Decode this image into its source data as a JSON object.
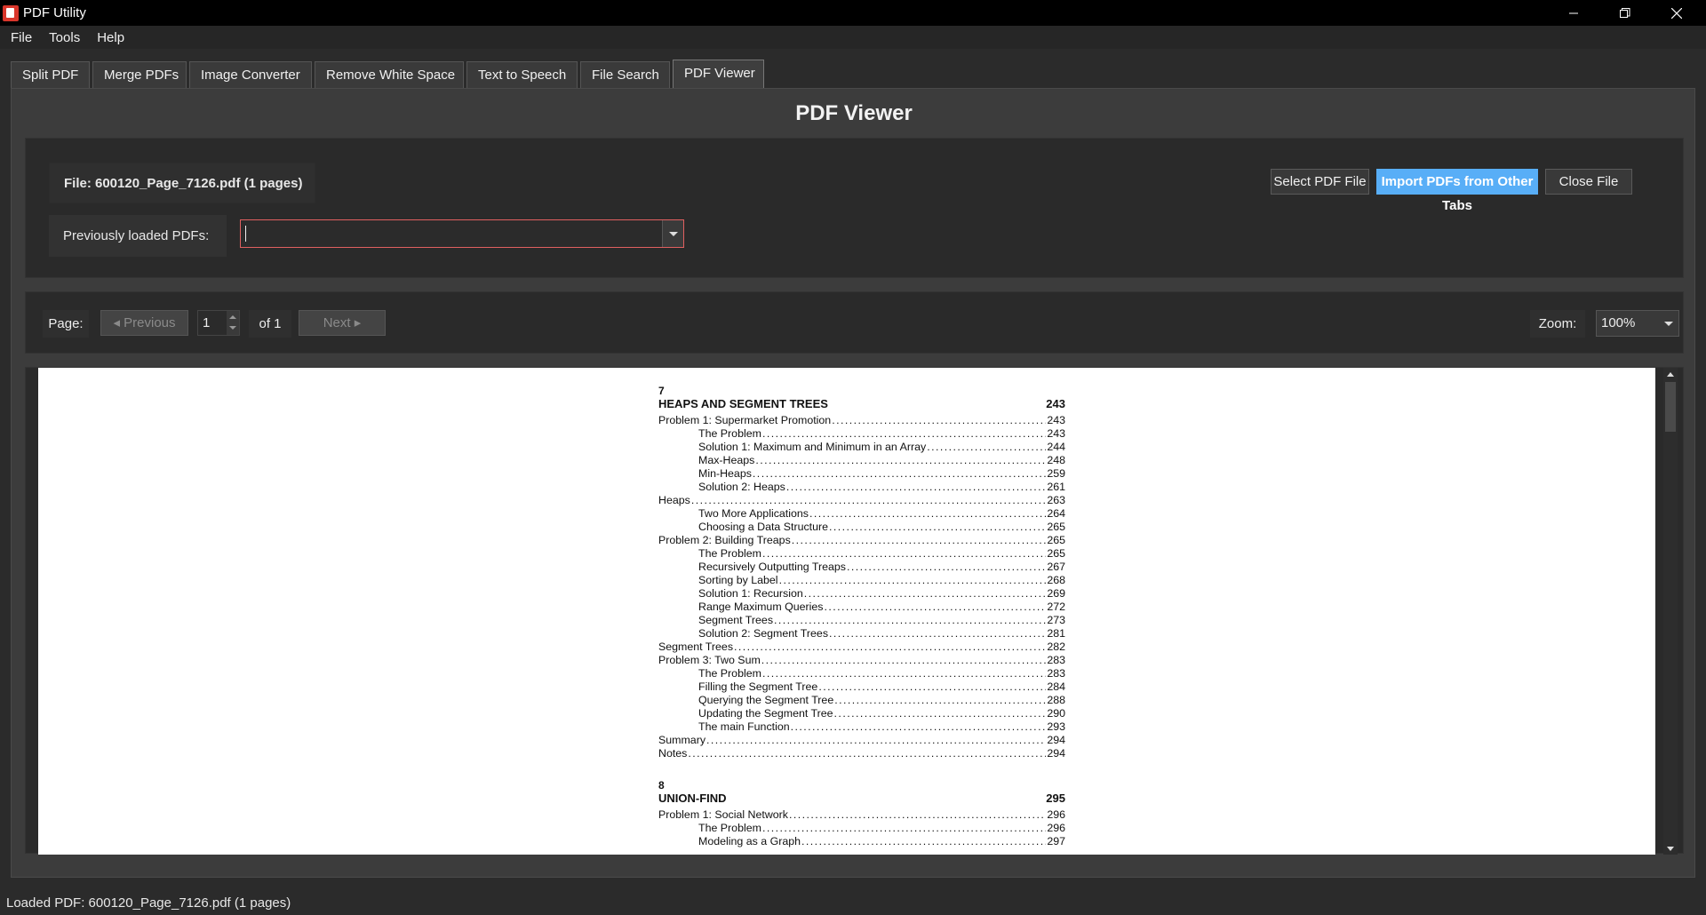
{
  "window": {
    "title": "PDF Utility"
  },
  "menu": [
    {
      "label": "File"
    },
    {
      "label": "Tools"
    },
    {
      "label": "Help"
    }
  ],
  "tabs": [
    {
      "label": "Split PDF"
    },
    {
      "label": "Merge PDFs"
    },
    {
      "label": "Image Converter"
    },
    {
      "label": "Remove White Space"
    },
    {
      "label": "Text to Speech"
    },
    {
      "label": "File Search"
    },
    {
      "label": "PDF Viewer",
      "active": true
    }
  ],
  "viewer": {
    "heading": "PDF Viewer",
    "file_label": "File: 600120_Page_7126.pdf (1 pages)",
    "previously_loaded_label": "Previously loaded PDFs:",
    "previously_loaded_value": "",
    "buttons": {
      "select": "Select PDF File",
      "import": "Import PDFs from Other Tabs",
      "close": "Close File"
    },
    "nav": {
      "page_label": "Page:",
      "previous": "◂ Previous",
      "page_value": "1",
      "of_label": "of 1",
      "next": "Next ▸",
      "zoom_label": "Zoom:",
      "zoom_value": "100%"
    },
    "document": {
      "chapters": [
        {
          "number": "7",
          "title": "HEAPS AND SEGMENT TREES",
          "page": "243",
          "entries": [
            {
              "level": 1,
              "title": "Problem 1: Supermarket Promotion",
              "page": "243"
            },
            {
              "level": 2,
              "title": "The Problem",
              "page": "243"
            },
            {
              "level": 2,
              "title": "Solution 1: Maximum and Minimum in an Array",
              "page": "244"
            },
            {
              "level": 2,
              "title": "Max-Heaps",
              "page": "248"
            },
            {
              "level": 2,
              "title": "Min-Heaps",
              "page": "259"
            },
            {
              "level": 2,
              "title": "Solution 2: Heaps",
              "page": "261"
            },
            {
              "level": 1,
              "title": "Heaps",
              "page": "263"
            },
            {
              "level": 2,
              "title": "Two More Applications",
              "page": "264"
            },
            {
              "level": 2,
              "title": "Choosing a Data Structure",
              "page": "265"
            },
            {
              "level": 1,
              "title": "Problem 2: Building Treaps",
              "page": "265"
            },
            {
              "level": 2,
              "title": "The Problem",
              "page": "265"
            },
            {
              "level": 2,
              "title": "Recursively Outputting Treaps",
              "page": "267"
            },
            {
              "level": 2,
              "title": "Sorting by Label",
              "page": "268"
            },
            {
              "level": 2,
              "title": "Solution 1: Recursion",
              "page": "269"
            },
            {
              "level": 2,
              "title": "Range Maximum Queries",
              "page": "272"
            },
            {
              "level": 2,
              "title": "Segment Trees",
              "page": "273"
            },
            {
              "level": 2,
              "title": "Solution 2: Segment Trees",
              "page": "281"
            },
            {
              "level": 1,
              "title": "Segment Trees",
              "page": "282"
            },
            {
              "level": 1,
              "title": "Problem 3: Two Sum",
              "page": "283"
            },
            {
              "level": 2,
              "title": "The Problem",
              "page": "283"
            },
            {
              "level": 2,
              "title": "Filling the Segment Tree",
              "page": "284"
            },
            {
              "level": 2,
              "title": "Querying the Segment Tree",
              "page": "288"
            },
            {
              "level": 2,
              "title": "Updating the Segment Tree",
              "page": "290"
            },
            {
              "level": 2,
              "title": "The main Function",
              "page": "293"
            },
            {
              "level": 1,
              "title": "Summary",
              "page": "294"
            },
            {
              "level": 1,
              "title": "Notes",
              "page": "294"
            }
          ]
        },
        {
          "number": "8",
          "title": "UNION-FIND",
          "page": "295",
          "entries": [
            {
              "level": 1,
              "title": "Problem 1: Social Network",
              "page": "296"
            },
            {
              "level": 2,
              "title": "The Problem",
              "page": "296"
            },
            {
              "level": 2,
              "title": "Modeling as a Graph",
              "page": "297"
            }
          ]
        }
      ]
    }
  },
  "status": {
    "text": "Loaded PDF: 600120_Page_7126.pdf (1 pages)"
  },
  "colors": {
    "accent": "#58aef7",
    "combo_border_error": "#e06060",
    "app_icon": "#d9362b"
  }
}
